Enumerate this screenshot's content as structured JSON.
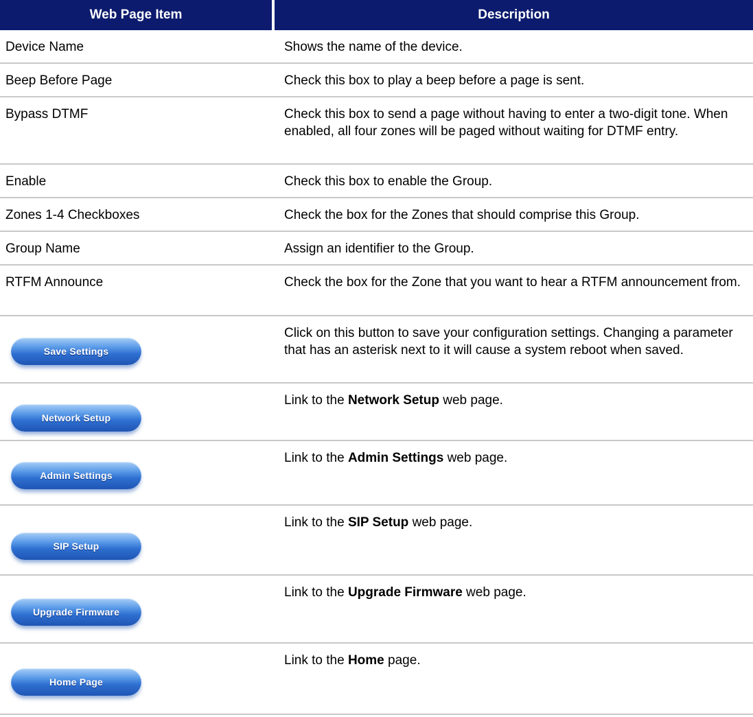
{
  "header": {
    "col1": "Web Page Item",
    "col2": "Description"
  },
  "rows": [
    {
      "item": "Device Name",
      "desc": "Shows the name of the device."
    },
    {
      "item": "Beep Before Page",
      "desc": "Check this box to play a beep before a page is sent."
    },
    {
      "item": "Bypass DTMF",
      "desc": "Check this box to send a page without having to enter a two-digit tone. When enabled, all four zones will be paged without waiting for DTMF entry."
    },
    {
      "item": "Enable",
      "desc": "Check this box to enable the Group."
    },
    {
      "item": "Zones 1-4 Checkboxes",
      "desc": "Check the box for the Zones that should comprise this Group."
    },
    {
      "item": "Group Name",
      "desc": "Assign an identifier to the Group."
    },
    {
      "item": "RTFM Announce",
      "desc": "Check the box for the Zone that you want to hear a RTFM announcement from."
    }
  ],
  "buttons": [
    {
      "label": "Save Settings",
      "desc": "Click on this button to save your configuration settings. Changing a parameter that has an asterisk next to it will cause a system reboot when saved."
    },
    {
      "label": "Network Setup",
      "pre": "Link to the ",
      "bold": "Network Setup",
      "post": " web page."
    },
    {
      "label": "Admin Settings",
      "pre": "Link to the ",
      "bold": "Admin Settings",
      "post": " web page."
    },
    {
      "label": "SIP Setup",
      "pre": "Link to the ",
      "bold": "SIP Setup",
      "post": " web page."
    },
    {
      "label": "Upgrade Firmware",
      "pre": "Link to the ",
      "bold": "Upgrade Firmware",
      "post": " web page."
    },
    {
      "label": "Home Page",
      "pre": "Link to the ",
      "bold": "Home",
      "post": " page."
    }
  ]
}
